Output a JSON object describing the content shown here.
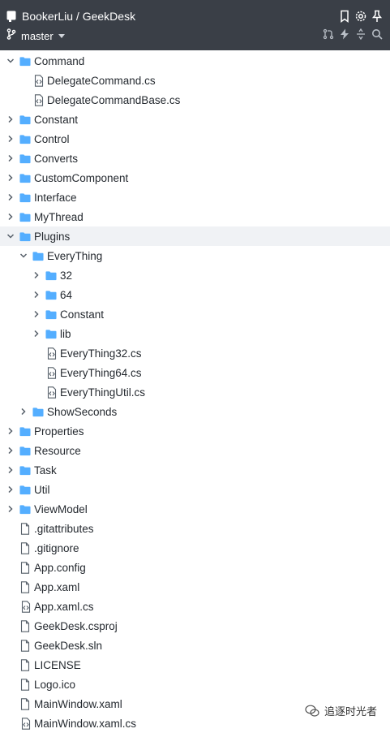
{
  "header": {
    "repo_title": "BookerLiu / GeekDesk",
    "branch": "master",
    "top_icons": [
      "bookmark-icon",
      "gear-icon",
      "pin-icon"
    ],
    "bottom_icons": [
      "pull-request-icon",
      "lightning-icon",
      "diff-icon",
      "search-icon"
    ]
  },
  "tree": [
    {
      "label": "Command",
      "type": "folder",
      "depth": 0,
      "expanded": true
    },
    {
      "label": "DelegateCommand.cs",
      "type": "code",
      "depth": 1
    },
    {
      "label": "DelegateCommandBase.cs",
      "type": "code",
      "depth": 1
    },
    {
      "label": "Constant",
      "type": "folder",
      "depth": 0,
      "expanded": false
    },
    {
      "label": "Control",
      "type": "folder",
      "depth": 0,
      "expanded": false
    },
    {
      "label": "Converts",
      "type": "folder",
      "depth": 0,
      "expanded": false
    },
    {
      "label": "CustomComponent",
      "type": "folder",
      "depth": 0,
      "expanded": false
    },
    {
      "label": "Interface",
      "type": "folder",
      "depth": 0,
      "expanded": false
    },
    {
      "label": "MyThread",
      "type": "folder",
      "depth": 0,
      "expanded": false
    },
    {
      "label": "Plugins",
      "type": "folder",
      "depth": 0,
      "expanded": true,
      "selected": true
    },
    {
      "label": "EveryThing",
      "type": "folder",
      "depth": 1,
      "expanded": true
    },
    {
      "label": "32",
      "type": "folder",
      "depth": 2,
      "expanded": false
    },
    {
      "label": "64",
      "type": "folder",
      "depth": 2,
      "expanded": false
    },
    {
      "label": "Constant",
      "type": "folder",
      "depth": 2,
      "expanded": false
    },
    {
      "label": "lib",
      "type": "folder",
      "depth": 2,
      "expanded": false
    },
    {
      "label": "EveryThing32.cs",
      "type": "code",
      "depth": 2
    },
    {
      "label": "EveryThing64.cs",
      "type": "code",
      "depth": 2
    },
    {
      "label": "EveryThingUtil.cs",
      "type": "code",
      "depth": 2
    },
    {
      "label": "ShowSeconds",
      "type": "folder",
      "depth": 1,
      "expanded": false
    },
    {
      "label": "Properties",
      "type": "folder",
      "depth": 0,
      "expanded": false
    },
    {
      "label": "Resource",
      "type": "folder",
      "depth": 0,
      "expanded": false
    },
    {
      "label": "Task",
      "type": "folder",
      "depth": 0,
      "expanded": false
    },
    {
      "label": "Util",
      "type": "folder",
      "depth": 0,
      "expanded": false
    },
    {
      "label": "ViewModel",
      "type": "folder",
      "depth": 0,
      "expanded": false
    },
    {
      "label": ".gitattributes",
      "type": "file",
      "depth": 0
    },
    {
      "label": ".gitignore",
      "type": "file",
      "depth": 0
    },
    {
      "label": "App.config",
      "type": "file",
      "depth": 0
    },
    {
      "label": "App.xaml",
      "type": "file",
      "depth": 0
    },
    {
      "label": "App.xaml.cs",
      "type": "code",
      "depth": 0
    },
    {
      "label": "GeekDesk.csproj",
      "type": "file",
      "depth": 0
    },
    {
      "label": "GeekDesk.sln",
      "type": "file",
      "depth": 0
    },
    {
      "label": "LICENSE",
      "type": "file",
      "depth": 0
    },
    {
      "label": "Logo.ico",
      "type": "file",
      "depth": 0
    },
    {
      "label": "MainWindow.xaml",
      "type": "file",
      "depth": 0
    },
    {
      "label": "MainWindow.xaml.cs",
      "type": "code",
      "depth": 0
    }
  ],
  "watermark": {
    "text": "追逐时光者"
  },
  "colors": {
    "folder": "#54aeff",
    "header_bg": "#3a3f47",
    "text": "#24292f",
    "icon": "#57606a",
    "selected_row": "#f0f2f5"
  }
}
